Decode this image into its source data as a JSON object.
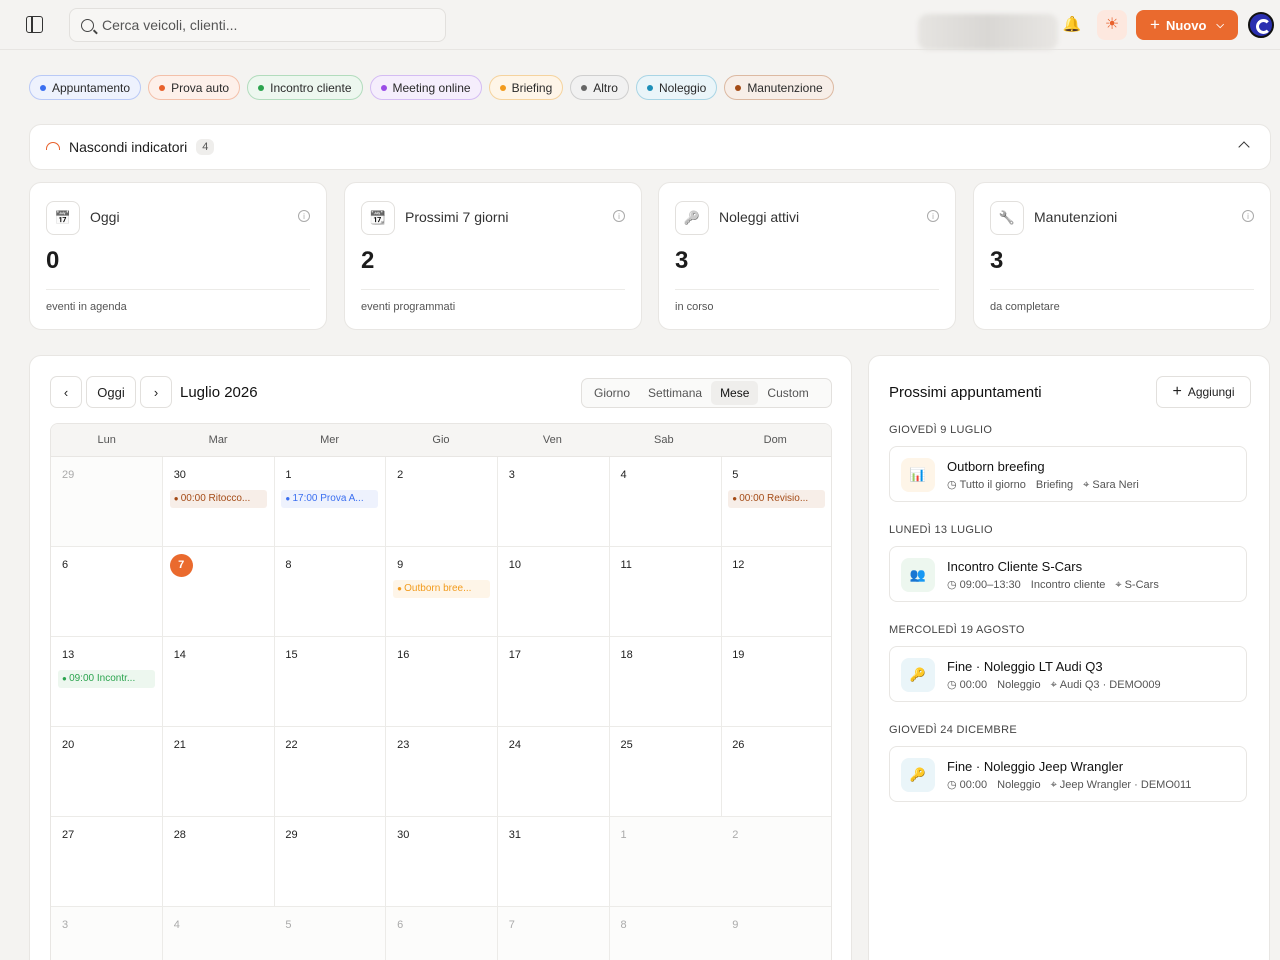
{
  "header": {
    "search_placeholder": "Cerca veicoli, clienti...",
    "new_label": "Nuovo"
  },
  "colors": {
    "accent": "#ea6a2e"
  },
  "event_types": [
    {
      "label": "Appuntamento",
      "color": "#3b6ff0",
      "bg": "#eef2fd",
      "border": "#b9c9f6"
    },
    {
      "label": "Prova auto",
      "color": "#e8612c",
      "bg": "#fdf0ea",
      "border": "#f3c0aa"
    },
    {
      "label": "Incontro cliente",
      "color": "#2ba44e",
      "bg": "#edf7ef",
      "border": "#b2dcbd"
    },
    {
      "label": "Meeting online",
      "color": "#9a4ce6",
      "bg": "#f5eefc",
      "border": "#d4bcf3"
    },
    {
      "label": "Briefing",
      "color": "#f29b1d",
      "bg": "#fef5e8",
      "border": "#f5d39e"
    },
    {
      "label": "Altro",
      "color": "#666666",
      "bg": "#f1f1f1",
      "border": "#cfcfcf"
    },
    {
      "label": "Noleggio",
      "color": "#1c8fb8",
      "bg": "#eaf5f9",
      "border": "#a9d5e5"
    },
    {
      "label": "Manutenzione",
      "color": "#a44b16",
      "bg": "#f7eee8",
      "border": "#dcb9a2"
    }
  ],
  "indicators": {
    "toggle_label": "Nascondi indicatori",
    "count": "4"
  },
  "stats": [
    {
      "label": "Oggi",
      "value": "0",
      "sub": "eventi in agenda",
      "icon": "calendar-clock-icon"
    },
    {
      "label": "Prossimi 7 giorni",
      "value": "2",
      "sub": "eventi programmati",
      "icon": "calendar-icon"
    },
    {
      "label": "Noleggi attivi",
      "value": "3",
      "sub": "in corso",
      "icon": "key-icon"
    },
    {
      "label": "Manutenzioni",
      "value": "3",
      "sub": "da completare",
      "icon": "wrench-icon"
    }
  ],
  "calendar": {
    "today_label": "Oggi",
    "month_title": "Luglio 2026",
    "views": [
      "Giorno",
      "Settimana",
      "Mese",
      "Custom"
    ],
    "active_view": "Mese",
    "weekdays": [
      "Lun",
      "Mar",
      "Mer",
      "Gio",
      "Ven",
      "Sab",
      "Dom"
    ],
    "weeks": [
      [
        "29",
        "30",
        "1",
        "2",
        "3",
        "4",
        "5"
      ],
      [
        "6",
        "7",
        "8",
        "9",
        "10",
        "11",
        "12"
      ],
      [
        "13",
        "14",
        "15",
        "16",
        "17",
        "18",
        "19"
      ],
      [
        "20",
        "21",
        "22",
        "23",
        "24",
        "25",
        "26"
      ],
      [
        "27",
        "28",
        "29",
        "30",
        "31",
        "1",
        "2"
      ],
      [
        "3",
        "4",
        "5",
        "6",
        "7",
        "8",
        "9"
      ]
    ],
    "today_cell": [
      1,
      1
    ],
    "events": [
      {
        "week": 0,
        "day": 1,
        "text": "00:00 Ritocco...",
        "color": "#a44b16",
        "bg": "#f7eee8"
      },
      {
        "week": 0,
        "day": 2,
        "text": "17:00 Prova A...",
        "color": "#3b6ff0",
        "bg": "#eef2fd"
      },
      {
        "week": 0,
        "day": 6,
        "text": "00:00 Revisio...",
        "color": "#a44b16",
        "bg": "#f7eee8"
      },
      {
        "week": 1,
        "day": 3,
        "text": "Outborn bree...",
        "color": "#f29b1d",
        "bg": "#fef5e8"
      },
      {
        "week": 2,
        "day": 0,
        "text": "09:00 Incontr...",
        "color": "#2ba44e",
        "bg": "#edf7ef"
      }
    ]
  },
  "upcoming": {
    "title": "Prossimi appuntamenti",
    "add_label": "Aggiungi",
    "groups": [
      {
        "day": "GIOVEDÌ 9 LUGLIO",
        "title": "Outborn breefing",
        "time": "Tutto il giorno",
        "type": "Briefing",
        "place": "Sara Neri",
        "icon": "presentation-icon",
        "icon_color": "#f29b1d",
        "icon_bg": "#fef5e8"
      },
      {
        "day": "LUNEDÌ 13 LUGLIO",
        "title": "Incontro Cliente S-Cars",
        "time": "09:00–13:30",
        "type": "Incontro cliente",
        "place": "S-Cars",
        "icon": "users-icon",
        "icon_color": "#2ba44e",
        "icon_bg": "#edf7ef"
      },
      {
        "day": "MERCOLEDÌ 19 AGOSTO",
        "title": "Fine · Noleggio LT Audi Q3",
        "time": "00:00",
        "type": "Noleggio",
        "place": "Audi Q3 · DEMO009",
        "icon": "key-icon",
        "icon_color": "#1c8fb8",
        "icon_bg": "#eaf5f9"
      },
      {
        "day": "GIOVEDÌ 24 DICEMBRE",
        "title": "Fine · Noleggio Jeep Wrangler",
        "time": "00:00",
        "type": "Noleggio",
        "place": "Jeep Wrangler · DEMO011",
        "icon": "key-icon",
        "icon_color": "#1c8fb8",
        "icon_bg": "#eaf5f9"
      }
    ]
  }
}
